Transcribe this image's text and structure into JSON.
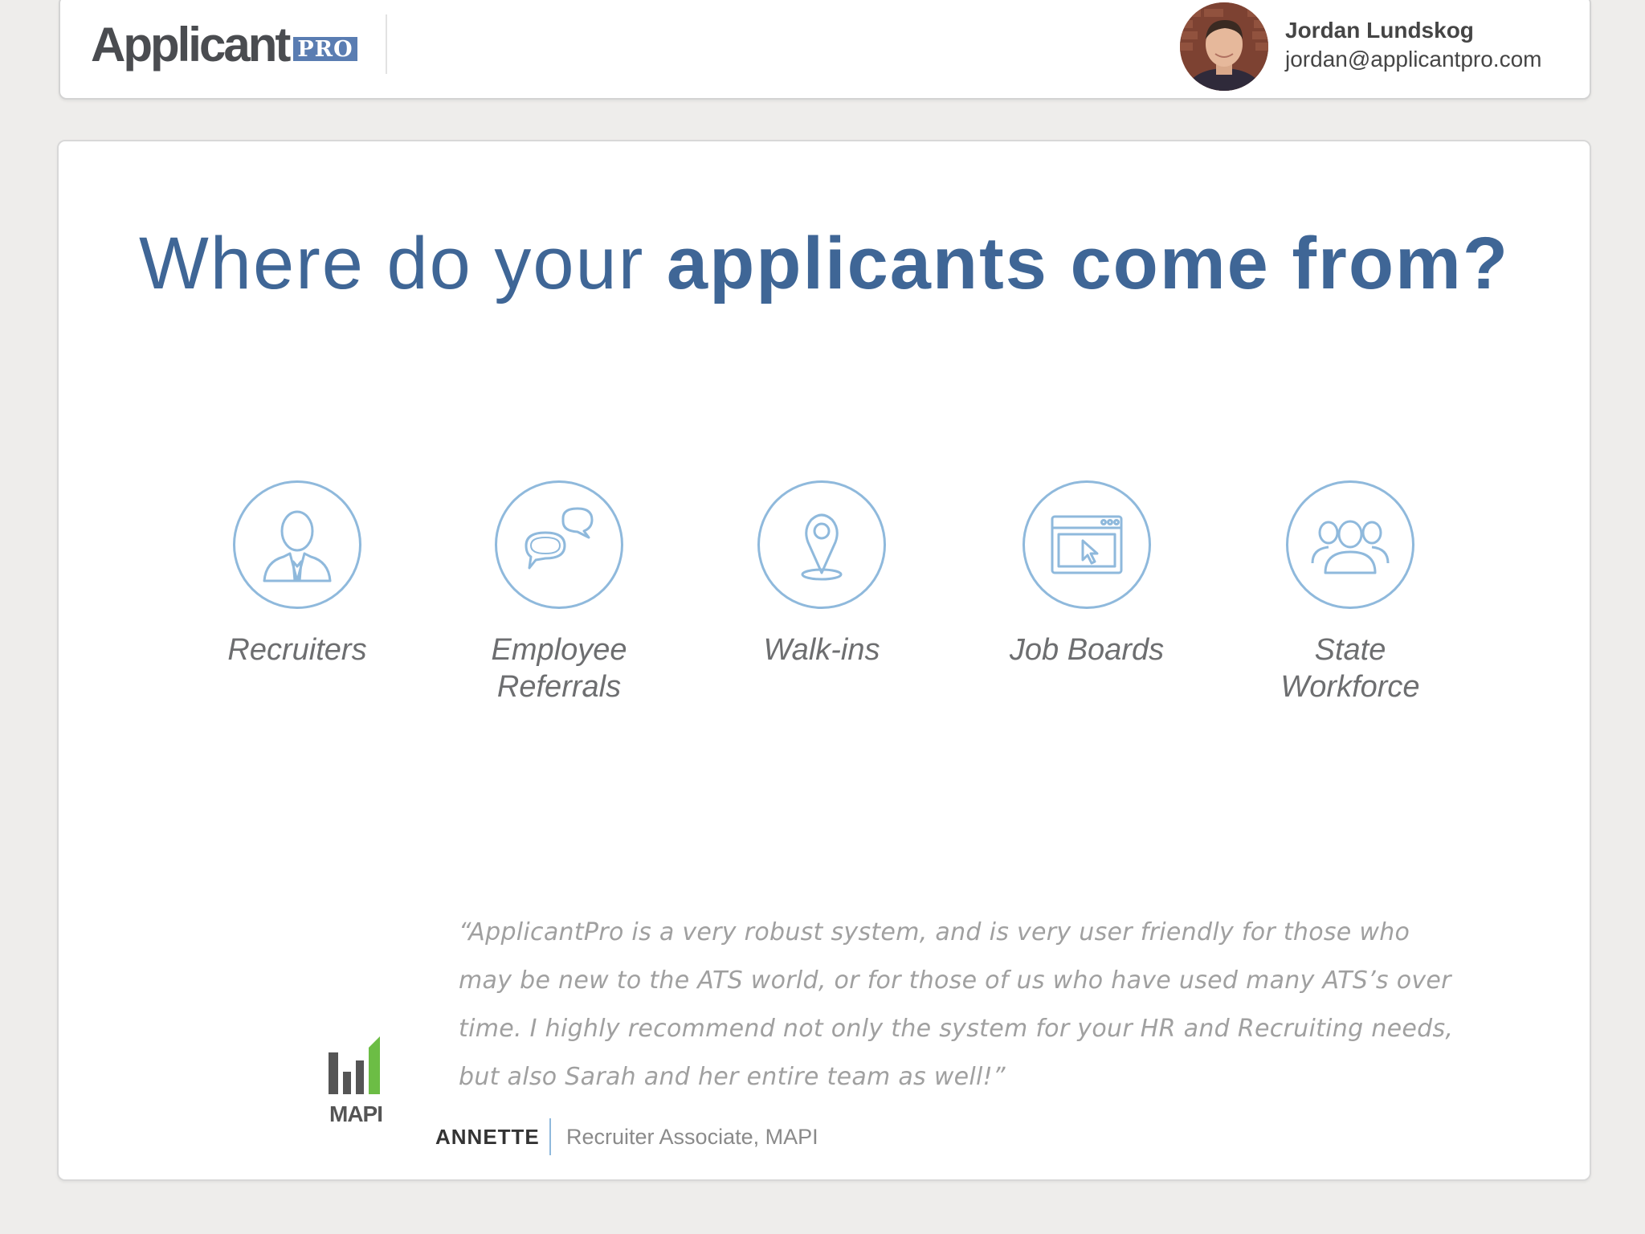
{
  "header": {
    "logo_word": "Applicant",
    "logo_badge": "PRO",
    "user": {
      "name": "Jordan Lundskog",
      "email": "jordan@applicantpro.com"
    }
  },
  "slide": {
    "headline_light": "Where do your ",
    "headline_bold": "applicants come from?",
    "sources": [
      {
        "label": "Recruiters",
        "icon": "recruiter-person-icon"
      },
      {
        "label": "Employee Referrals",
        "icon": "speech-bubbles-icon"
      },
      {
        "label": "Walk-ins",
        "icon": "map-pin-icon"
      },
      {
        "label": "Job Boards",
        "icon": "browser-cursor-icon"
      },
      {
        "label": "State Workforce",
        "icon": "people-group-icon"
      }
    ],
    "testimonial": {
      "quote": "“ApplicantPro is a very robust system, and is very user friendly for those who may be new to the ATS world, or for those of us who have used many ATS’s over time. I highly recommend not only the system for your HR and Recruiting needs, but also Sarah and her entire team as well!”",
      "name": "ANNETTE",
      "role": "Recruiter Associate, MAPI",
      "company_logo_text": "MAPI"
    }
  },
  "colors": {
    "headline": "#3f6696",
    "icon_ring": "#8fb9dc",
    "label": "#6d6e70",
    "mapi_green": "#6cbd45",
    "mapi_gray": "#555555"
  }
}
